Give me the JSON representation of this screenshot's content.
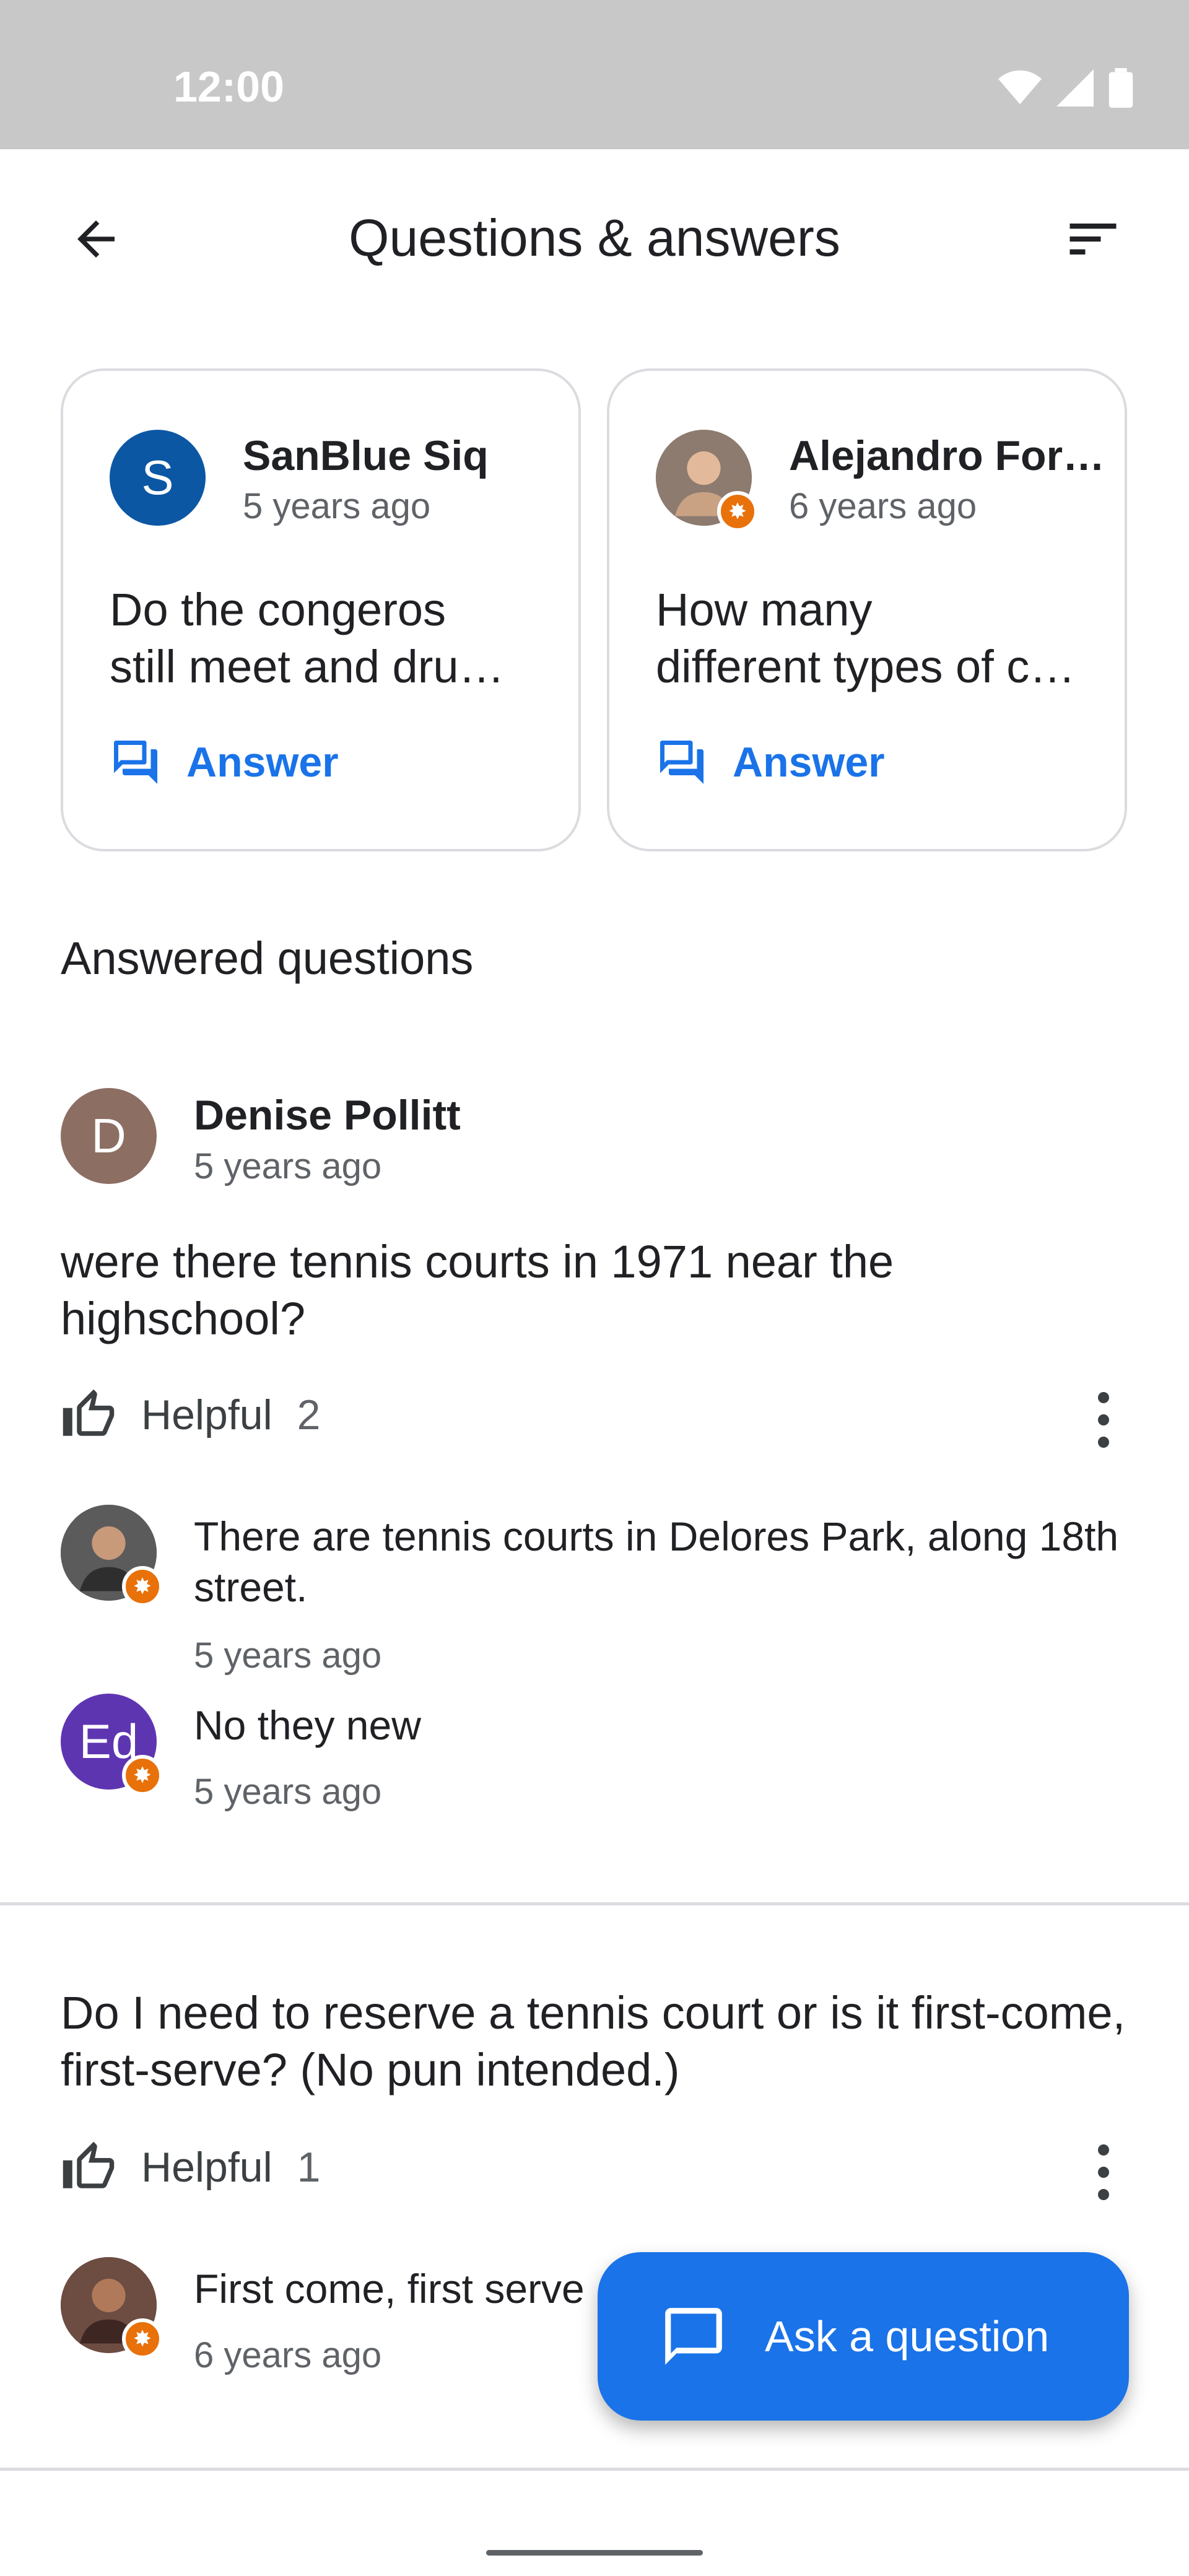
{
  "status_bar": {
    "time": "12:00",
    "icons": [
      "wifi-icon",
      "signal-icon",
      "battery-icon"
    ]
  },
  "app_bar": {
    "title": "Questions & answers",
    "back_icon": "arrow-back-icon",
    "sort_icon": "sort-icon"
  },
  "unanswered_cards": [
    {
      "author": "SanBlue Siq",
      "avatar_letter": "S",
      "avatar_color": "#0b57a4",
      "time": "5 years ago",
      "question_line1": "Do the congeros",
      "question_line2": "still meet and drum on Sundays?",
      "answer_label": "Answer"
    },
    {
      "author": "Alejandro Forero",
      "avatar_color": "#8d7b6f",
      "time": "6 years ago",
      "question_line1": "How many",
      "question_line2": "different types of courts are there?",
      "answer_label": "Answer"
    }
  ],
  "answered_section": {
    "title": "Answered questions"
  },
  "answered": [
    {
      "author": "Denise Pollitt",
      "avatar_letter": "D",
      "avatar_color": "#8d6e63",
      "time": "5 years ago",
      "question": "were there tennis courts in 1971 near the highschool?",
      "helpful_label": "Helpful",
      "helpful_count": "2",
      "answers": [
        {
          "text": "There are tennis courts in Delores Park, along 18th street.",
          "time": "5 years ago",
          "avatar_color": "#4a4a4a"
        },
        {
          "text": "No they new",
          "time": "5 years ago",
          "avatar_letter": "Ed",
          "avatar_color": "#5e35b1"
        }
      ]
    },
    {
      "question": "Do I need to reserve a tennis court or is it first-come, first-serve? (No pun intended.)",
      "helpful_label": "Helpful",
      "helpful_count": "1",
      "answers": [
        {
          "text": "First come, first serve",
          "time": "6 years ago",
          "avatar_color": "#6d4c41"
        }
      ]
    }
  ],
  "fab": {
    "label": "Ask a question",
    "icon": "chat-bubble-icon"
  },
  "colors": {
    "accent": "#1a73e8",
    "badge": "#e8710a",
    "status_bar": "#c8c8c8"
  }
}
